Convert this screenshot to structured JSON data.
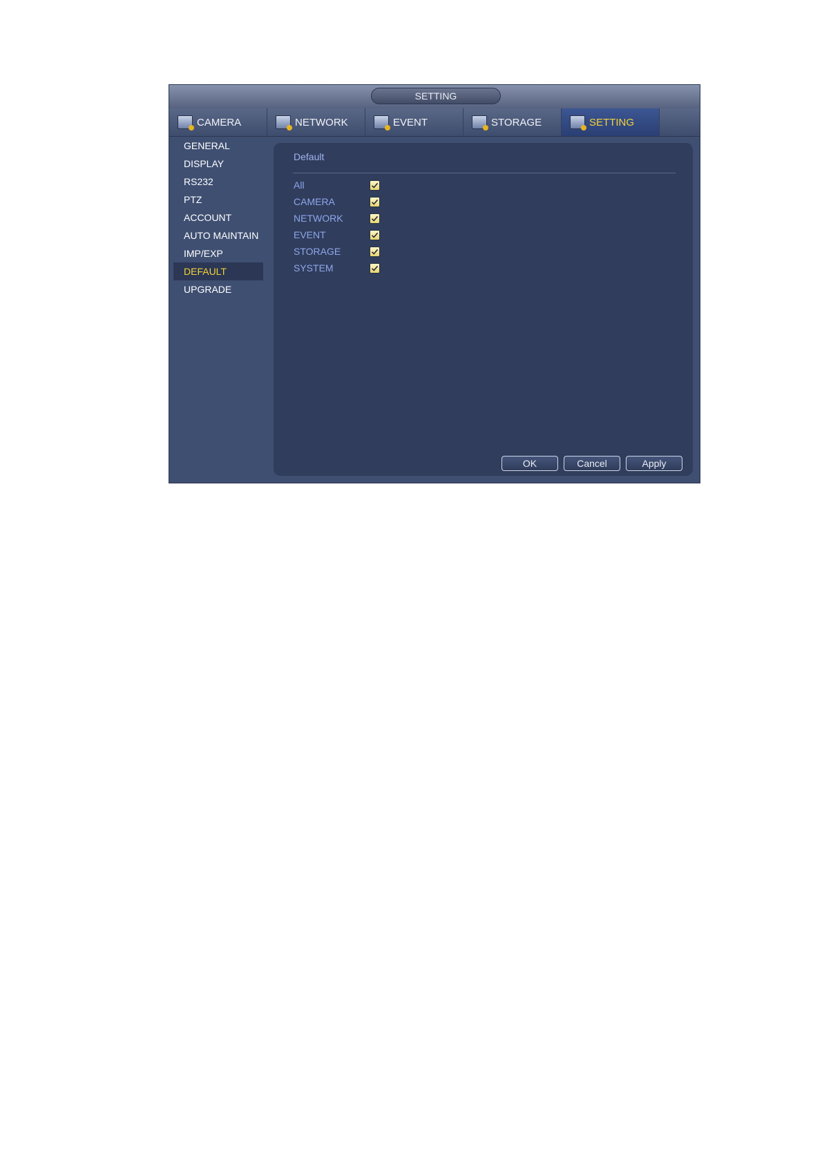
{
  "window": {
    "title": "SETTING"
  },
  "tabs": [
    {
      "label": "CAMERA",
      "icon": "camera-icon"
    },
    {
      "label": "NETWORK",
      "icon": "network-icon"
    },
    {
      "label": "EVENT",
      "icon": "event-icon"
    },
    {
      "label": "STORAGE",
      "icon": "storage-icon"
    },
    {
      "label": "SETTING",
      "icon": "setting-icon",
      "active": true
    }
  ],
  "sidebar": {
    "items": [
      {
        "label": "GENERAL"
      },
      {
        "label": "DISPLAY"
      },
      {
        "label": "RS232"
      },
      {
        "label": "PTZ"
      },
      {
        "label": "ACCOUNT"
      },
      {
        "label": "AUTO MAINTAIN"
      },
      {
        "label": "IMP/EXP"
      },
      {
        "label": "DEFAULT",
        "active": true
      },
      {
        "label": "UPGRADE"
      }
    ]
  },
  "panel": {
    "title": "Default",
    "options": [
      {
        "label": "All",
        "checked": true
      },
      {
        "label": "CAMERA",
        "checked": true
      },
      {
        "label": "NETWORK",
        "checked": true
      },
      {
        "label": "EVENT",
        "checked": true
      },
      {
        "label": "STORAGE",
        "checked": true
      },
      {
        "label": "SYSTEM",
        "checked": true
      }
    ]
  },
  "buttons": {
    "ok": "OK",
    "cancel": "Cancel",
    "apply": "Apply"
  },
  "colors": {
    "active_text": "#f5d23a",
    "option_text": "#8ea6ec",
    "window_bg": "#3f4f72",
    "panel_bg": "#303d5c"
  }
}
